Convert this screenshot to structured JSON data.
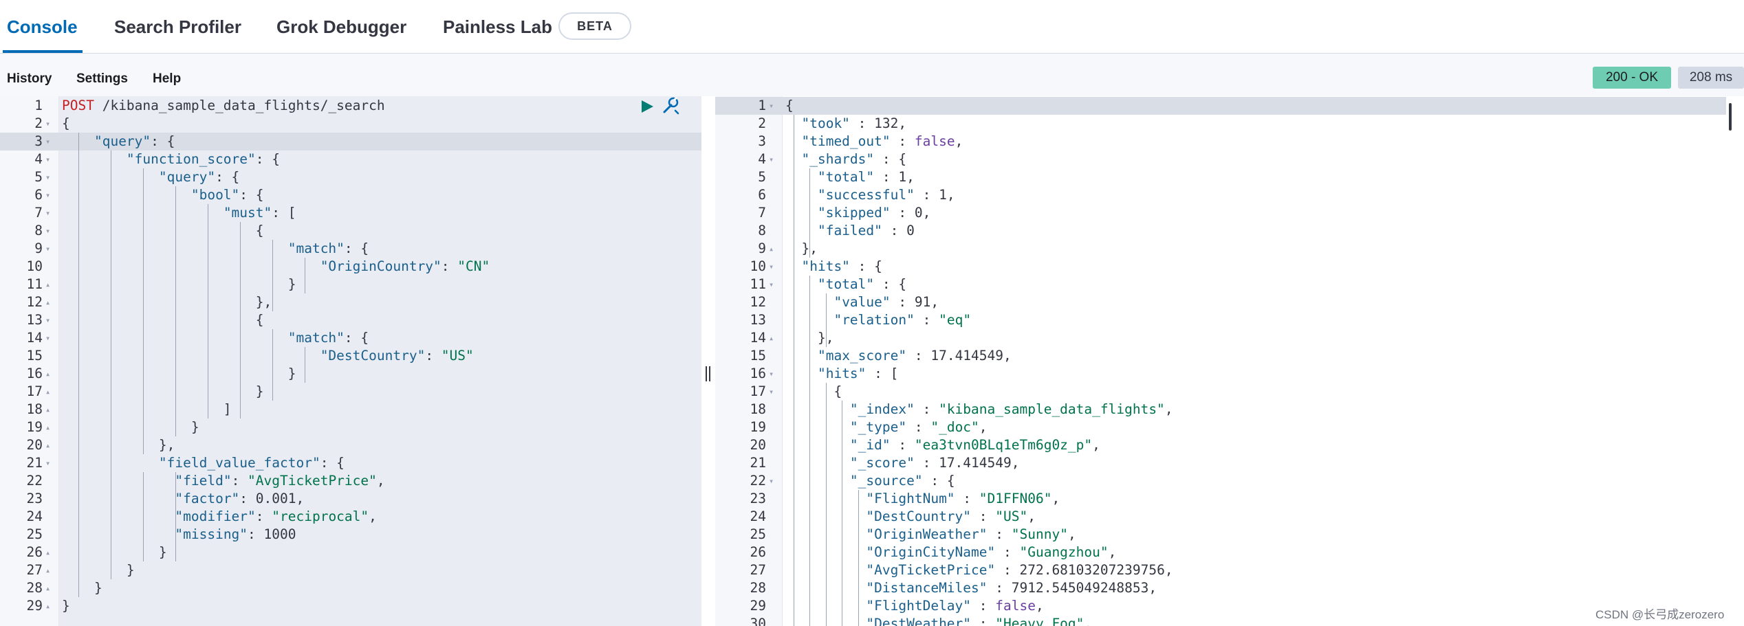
{
  "tabs": [
    {
      "label": "Console"
    },
    {
      "label": "Search Profiler"
    },
    {
      "label": "Grok Debugger"
    },
    {
      "label": "Painless Lab"
    }
  ],
  "beta_badge": "BETA",
  "menu": {
    "history": "History",
    "settings": "Settings",
    "help": "Help"
  },
  "status": {
    "code": "200 - OK",
    "time": "208 ms",
    "ok_color": "#6dccb1"
  },
  "icons": {
    "run": "play-icon",
    "wrench": "wrench-icon"
  },
  "request_lines": [
    {
      "n": "1",
      "f": "",
      "t": [
        [
          "kw",
          "POST"
        ],
        [
          "url",
          " /kibana_sample_data_flights/_search"
        ]
      ]
    },
    {
      "n": "2",
      "f": "▾",
      "t": [
        [
          "punc",
          "{"
        ]
      ]
    },
    {
      "n": "3",
      "f": "▾",
      "t": [
        [
          "punc",
          "    "
        ],
        [
          "key",
          "\"query\""
        ],
        [
          "punc",
          ": {"
        ]
      ]
    },
    {
      "n": "4",
      "f": "▾",
      "t": [
        [
          "punc",
          "        "
        ],
        [
          "key",
          "\"function_score\""
        ],
        [
          "punc",
          ": {"
        ]
      ]
    },
    {
      "n": "5",
      "f": "▾",
      "t": [
        [
          "punc",
          "            "
        ],
        [
          "key",
          "\"query\""
        ],
        [
          "punc",
          ": {"
        ]
      ]
    },
    {
      "n": "6",
      "f": "▾",
      "t": [
        [
          "punc",
          "                "
        ],
        [
          "key",
          "\"bool\""
        ],
        [
          "punc",
          ": {"
        ]
      ]
    },
    {
      "n": "7",
      "f": "▾",
      "t": [
        [
          "punc",
          "                    "
        ],
        [
          "key",
          "\"must\""
        ],
        [
          "punc",
          ": ["
        ]
      ]
    },
    {
      "n": "8",
      "f": "▾",
      "t": [
        [
          "punc",
          "                        {"
        ]
      ]
    },
    {
      "n": "9",
      "f": "▾",
      "t": [
        [
          "punc",
          "                            "
        ],
        [
          "key",
          "\"match\""
        ],
        [
          "punc",
          ": {"
        ]
      ]
    },
    {
      "n": "10",
      "f": "",
      "t": [
        [
          "punc",
          "                                "
        ],
        [
          "key",
          "\"OriginCountry\""
        ],
        [
          "punc",
          ": "
        ],
        [
          "str",
          "\"CN\""
        ]
      ]
    },
    {
      "n": "11",
      "f": "▴",
      "t": [
        [
          "punc",
          "                            }"
        ]
      ]
    },
    {
      "n": "12",
      "f": "▴",
      "t": [
        [
          "punc",
          "                        },"
        ]
      ]
    },
    {
      "n": "13",
      "f": "▾",
      "t": [
        [
          "punc",
          "                        {"
        ]
      ]
    },
    {
      "n": "14",
      "f": "▾",
      "t": [
        [
          "punc",
          "                            "
        ],
        [
          "key",
          "\"match\""
        ],
        [
          "punc",
          ": {"
        ]
      ]
    },
    {
      "n": "15",
      "f": "",
      "t": [
        [
          "punc",
          "                                "
        ],
        [
          "key",
          "\"DestCountry\""
        ],
        [
          "punc",
          ": "
        ],
        [
          "str",
          "\"US\""
        ]
      ]
    },
    {
      "n": "16",
      "f": "▴",
      "t": [
        [
          "punc",
          "                            }"
        ]
      ]
    },
    {
      "n": "17",
      "f": "▴",
      "t": [
        [
          "punc",
          "                        }"
        ]
      ]
    },
    {
      "n": "18",
      "f": "▴",
      "t": [
        [
          "punc",
          "                    ]"
        ]
      ]
    },
    {
      "n": "19",
      "f": "▴",
      "t": [
        [
          "punc",
          "                }"
        ]
      ]
    },
    {
      "n": "20",
      "f": "▴",
      "t": [
        [
          "punc",
          "            },"
        ]
      ]
    },
    {
      "n": "21",
      "f": "▾",
      "t": [
        [
          "punc",
          "            "
        ],
        [
          "key",
          "\"field_value_factor\""
        ],
        [
          "punc",
          ": {"
        ]
      ]
    },
    {
      "n": "22",
      "f": "",
      "t": [
        [
          "punc",
          "              "
        ],
        [
          "key",
          "\"field\""
        ],
        [
          "punc",
          ": "
        ],
        [
          "str",
          "\"AvgTicketPrice\""
        ],
        [
          "punc",
          ","
        ]
      ]
    },
    {
      "n": "23",
      "f": "",
      "t": [
        [
          "punc",
          "              "
        ],
        [
          "key",
          "\"factor\""
        ],
        [
          "punc",
          ": "
        ],
        [
          "num",
          "0.001"
        ],
        [
          "punc",
          ","
        ]
      ]
    },
    {
      "n": "24",
      "f": "",
      "t": [
        [
          "punc",
          "              "
        ],
        [
          "key",
          "\"modifier\""
        ],
        [
          "punc",
          ": "
        ],
        [
          "str",
          "\"reciprocal\""
        ],
        [
          "punc",
          ","
        ]
      ]
    },
    {
      "n": "25",
      "f": "",
      "t": [
        [
          "punc",
          "              "
        ],
        [
          "key",
          "\"missing\""
        ],
        [
          "punc",
          ": "
        ],
        [
          "num",
          "1000"
        ]
      ]
    },
    {
      "n": "26",
      "f": "▴",
      "t": [
        [
          "punc",
          "            }"
        ]
      ]
    },
    {
      "n": "27",
      "f": "▴",
      "t": [
        [
          "punc",
          "        }"
        ]
      ]
    },
    {
      "n": "28",
      "f": "▴",
      "t": [
        [
          "punc",
          "    }"
        ]
      ]
    },
    {
      "n": "29",
      "f": "▴",
      "t": [
        [
          "punc",
          "}"
        ]
      ]
    }
  ],
  "response_lines": [
    {
      "n": "1",
      "f": "▾",
      "t": [
        [
          "punc",
          "{"
        ]
      ]
    },
    {
      "n": "2",
      "f": "",
      "t": [
        [
          "punc",
          "  "
        ],
        [
          "key",
          "\"took\""
        ],
        [
          "punc",
          " : "
        ],
        [
          "num",
          "132"
        ],
        [
          "punc",
          ","
        ]
      ]
    },
    {
      "n": "3",
      "f": "",
      "t": [
        [
          "punc",
          "  "
        ],
        [
          "key",
          "\"timed_out\""
        ],
        [
          "punc",
          " : "
        ],
        [
          "bool",
          "false"
        ],
        [
          "punc",
          ","
        ]
      ]
    },
    {
      "n": "4",
      "f": "▾",
      "t": [
        [
          "punc",
          "  "
        ],
        [
          "key",
          "\"_shards\""
        ],
        [
          "punc",
          " : {"
        ]
      ]
    },
    {
      "n": "5",
      "f": "",
      "t": [
        [
          "punc",
          "    "
        ],
        [
          "key",
          "\"total\""
        ],
        [
          "punc",
          " : "
        ],
        [
          "num",
          "1"
        ],
        [
          "punc",
          ","
        ]
      ]
    },
    {
      "n": "6",
      "f": "",
      "t": [
        [
          "punc",
          "    "
        ],
        [
          "key",
          "\"successful\""
        ],
        [
          "punc",
          " : "
        ],
        [
          "num",
          "1"
        ],
        [
          "punc",
          ","
        ]
      ]
    },
    {
      "n": "7",
      "f": "",
      "t": [
        [
          "punc",
          "    "
        ],
        [
          "key",
          "\"skipped\""
        ],
        [
          "punc",
          " : "
        ],
        [
          "num",
          "0"
        ],
        [
          "punc",
          ","
        ]
      ]
    },
    {
      "n": "8",
      "f": "",
      "t": [
        [
          "punc",
          "    "
        ],
        [
          "key",
          "\"failed\""
        ],
        [
          "punc",
          " : "
        ],
        [
          "num",
          "0"
        ]
      ]
    },
    {
      "n": "9",
      "f": "▴",
      "t": [
        [
          "punc",
          "  },"
        ]
      ]
    },
    {
      "n": "10",
      "f": "▾",
      "t": [
        [
          "punc",
          "  "
        ],
        [
          "key",
          "\"hits\""
        ],
        [
          "punc",
          " : {"
        ]
      ]
    },
    {
      "n": "11",
      "f": "▾",
      "t": [
        [
          "punc",
          "    "
        ],
        [
          "key",
          "\"total\""
        ],
        [
          "punc",
          " : {"
        ]
      ]
    },
    {
      "n": "12",
      "f": "",
      "t": [
        [
          "punc",
          "      "
        ],
        [
          "key",
          "\"value\""
        ],
        [
          "punc",
          " : "
        ],
        [
          "num",
          "91"
        ],
        [
          "punc",
          ","
        ]
      ]
    },
    {
      "n": "13",
      "f": "",
      "t": [
        [
          "punc",
          "      "
        ],
        [
          "key",
          "\"relation\""
        ],
        [
          "punc",
          " : "
        ],
        [
          "str",
          "\"eq\""
        ]
      ]
    },
    {
      "n": "14",
      "f": "▴",
      "t": [
        [
          "punc",
          "    },"
        ]
      ]
    },
    {
      "n": "15",
      "f": "",
      "t": [
        [
          "punc",
          "    "
        ],
        [
          "key",
          "\"max_score\""
        ],
        [
          "punc",
          " : "
        ],
        [
          "num",
          "17.414549"
        ],
        [
          "punc",
          ","
        ]
      ]
    },
    {
      "n": "16",
      "f": "▾",
      "t": [
        [
          "punc",
          "    "
        ],
        [
          "key",
          "\"hits\""
        ],
        [
          "punc",
          " : ["
        ]
      ]
    },
    {
      "n": "17",
      "f": "▾",
      "t": [
        [
          "punc",
          "      {"
        ]
      ]
    },
    {
      "n": "18",
      "f": "",
      "t": [
        [
          "punc",
          "        "
        ],
        [
          "key",
          "\"_index\""
        ],
        [
          "punc",
          " : "
        ],
        [
          "str",
          "\"kibana_sample_data_flights\""
        ],
        [
          "punc",
          ","
        ]
      ]
    },
    {
      "n": "19",
      "f": "",
      "t": [
        [
          "punc",
          "        "
        ],
        [
          "key",
          "\"_type\""
        ],
        [
          "punc",
          " : "
        ],
        [
          "str",
          "\"_doc\""
        ],
        [
          "punc",
          ","
        ]
      ]
    },
    {
      "n": "20",
      "f": "",
      "t": [
        [
          "punc",
          "        "
        ],
        [
          "key",
          "\"_id\""
        ],
        [
          "punc",
          " : "
        ],
        [
          "str",
          "\"ea3tvn0BLq1eTm6g0z_p\""
        ],
        [
          "punc",
          ","
        ]
      ]
    },
    {
      "n": "21",
      "f": "",
      "t": [
        [
          "punc",
          "        "
        ],
        [
          "key",
          "\"_score\""
        ],
        [
          "punc",
          " : "
        ],
        [
          "num",
          "17.414549"
        ],
        [
          "punc",
          ","
        ]
      ]
    },
    {
      "n": "22",
      "f": "▾",
      "t": [
        [
          "punc",
          "        "
        ],
        [
          "key",
          "\"_source\""
        ],
        [
          "punc",
          " : {"
        ]
      ]
    },
    {
      "n": "23",
      "f": "",
      "t": [
        [
          "punc",
          "          "
        ],
        [
          "key",
          "\"FlightNum\""
        ],
        [
          "punc",
          " : "
        ],
        [
          "str",
          "\"D1FFN06\""
        ],
        [
          "punc",
          ","
        ]
      ]
    },
    {
      "n": "24",
      "f": "",
      "t": [
        [
          "punc",
          "          "
        ],
        [
          "key",
          "\"DestCountry\""
        ],
        [
          "punc",
          " : "
        ],
        [
          "str",
          "\"US\""
        ],
        [
          "punc",
          ","
        ]
      ]
    },
    {
      "n": "25",
      "f": "",
      "t": [
        [
          "punc",
          "          "
        ],
        [
          "key",
          "\"OriginWeather\""
        ],
        [
          "punc",
          " : "
        ],
        [
          "str",
          "\"Sunny\""
        ],
        [
          "punc",
          ","
        ]
      ]
    },
    {
      "n": "26",
      "f": "",
      "t": [
        [
          "punc",
          "          "
        ],
        [
          "key",
          "\"OriginCityName\""
        ],
        [
          "punc",
          " : "
        ],
        [
          "str",
          "\"Guangzhou\""
        ],
        [
          "punc",
          ","
        ]
      ]
    },
    {
      "n": "27",
      "f": "",
      "t": [
        [
          "punc",
          "          "
        ],
        [
          "key",
          "\"AvgTicketPrice\""
        ],
        [
          "punc",
          " : "
        ],
        [
          "num",
          "272.68103207239756"
        ],
        [
          "punc",
          ","
        ]
      ]
    },
    {
      "n": "28",
      "f": "",
      "t": [
        [
          "punc",
          "          "
        ],
        [
          "key",
          "\"DistanceMiles\""
        ],
        [
          "punc",
          " : "
        ],
        [
          "num",
          "7912.545049248853"
        ],
        [
          "punc",
          ","
        ]
      ]
    },
    {
      "n": "29",
      "f": "",
      "t": [
        [
          "punc",
          "          "
        ],
        [
          "key",
          "\"FlightDelay\""
        ],
        [
          "punc",
          " : "
        ],
        [
          "bool",
          "false"
        ],
        [
          "punc",
          ","
        ]
      ]
    },
    {
      "n": "30",
      "f": "",
      "t": [
        [
          "punc",
          "          "
        ],
        [
          "key",
          "\"DestWeather\""
        ],
        [
          "punc",
          " : "
        ],
        [
          "str",
          "\"Heavy Fog\""
        ],
        [
          "punc",
          ","
        ]
      ]
    }
  ],
  "watermark": "CSDN @长弓成zerozero"
}
